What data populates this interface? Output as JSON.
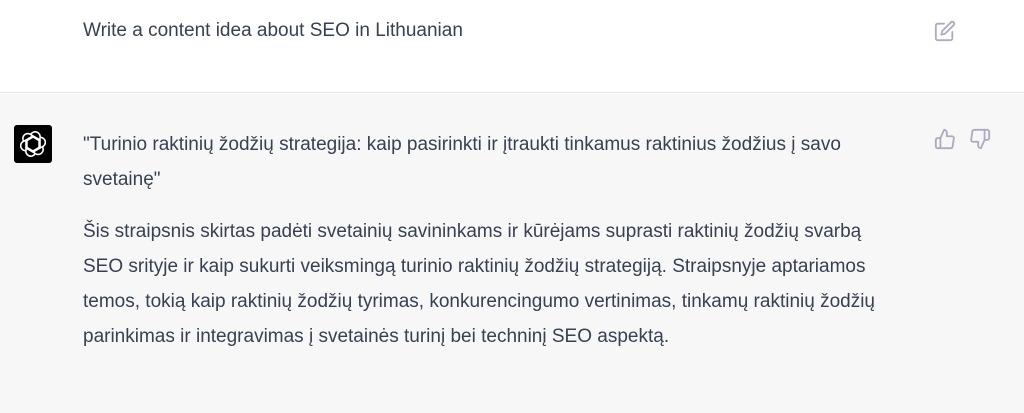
{
  "user_message": {
    "text": "Write a content idea about SEO in Lithuanian"
  },
  "assistant_message": {
    "title_paragraph": "\"Turinio raktinių žodžių strategija: kaip pasirinkti ir įtraukti tinkamus raktinius žodžius į savo svetainę\"",
    "body_paragraph": "Šis straipsnis skirtas padėti svetainių savininkams ir kūrėjams suprasti raktinių žodžių svarbą SEO srityje ir kaip sukurti veiksmingą turinio raktinių žodžių strategiją. Straipsnyje aptariamos temos, tokią kaip raktinių žodžių tyrimas, konkurencingumo vertinimas, tinkamų raktinių žodžių parinkimas ir integravimas į svetainės turinį bei techninį SEO aspektą."
  },
  "icons": {
    "edit": "edit-icon",
    "bot_logo": "openai-logo-icon",
    "thumbs_up": "thumbs-up-icon",
    "thumbs_down": "thumbs-down-icon"
  },
  "colors": {
    "assistant_background": "#f7f7f8",
    "user_background": "#ffffff",
    "text": "#374151",
    "icon": "#acacbe",
    "bot_avatar": "#000000"
  }
}
